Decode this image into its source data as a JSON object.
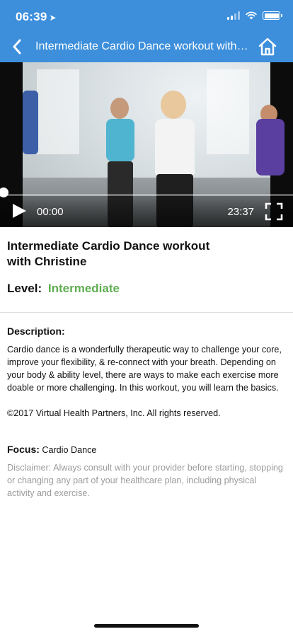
{
  "status_bar": {
    "time": "06:39",
    "location_glyph": "➤"
  },
  "nav": {
    "title": "Intermediate Cardio Dance workout with Christine",
    "back_icon": "chevron-left-icon",
    "home_icon": "home-icon"
  },
  "player": {
    "current_time": "00:00",
    "total_time": "23:37",
    "progress_fraction": 0
  },
  "workout": {
    "title": "Intermediate Cardio Dance workout with Christine",
    "level_label": "Level:",
    "level_value": "Intermediate",
    "description_heading": "Description:",
    "description_body": "Cardio dance is a wonderfully therapeutic way to challenge your core, improve your flexibility, & re-connect with your breath. Depending on your body & ability level, there are ways to make each exercise more doable or more challenging. In this workout, you will learn the basics.",
    "copyright": "©2017 Virtual Health Partners, Inc. All rights reserved.",
    "focus_label": "Focus:",
    "focus_value": "Cardio Dance",
    "disclaimer": "Disclaimer: Always consult with your provider before starting, stopping or changing any part of your healthcare plan, including physical activity and exercise."
  },
  "colors": {
    "header_blue": "#3d8fdc",
    "level_green": "#5fae52",
    "disclaimer_gray": "#9b9b9b"
  }
}
